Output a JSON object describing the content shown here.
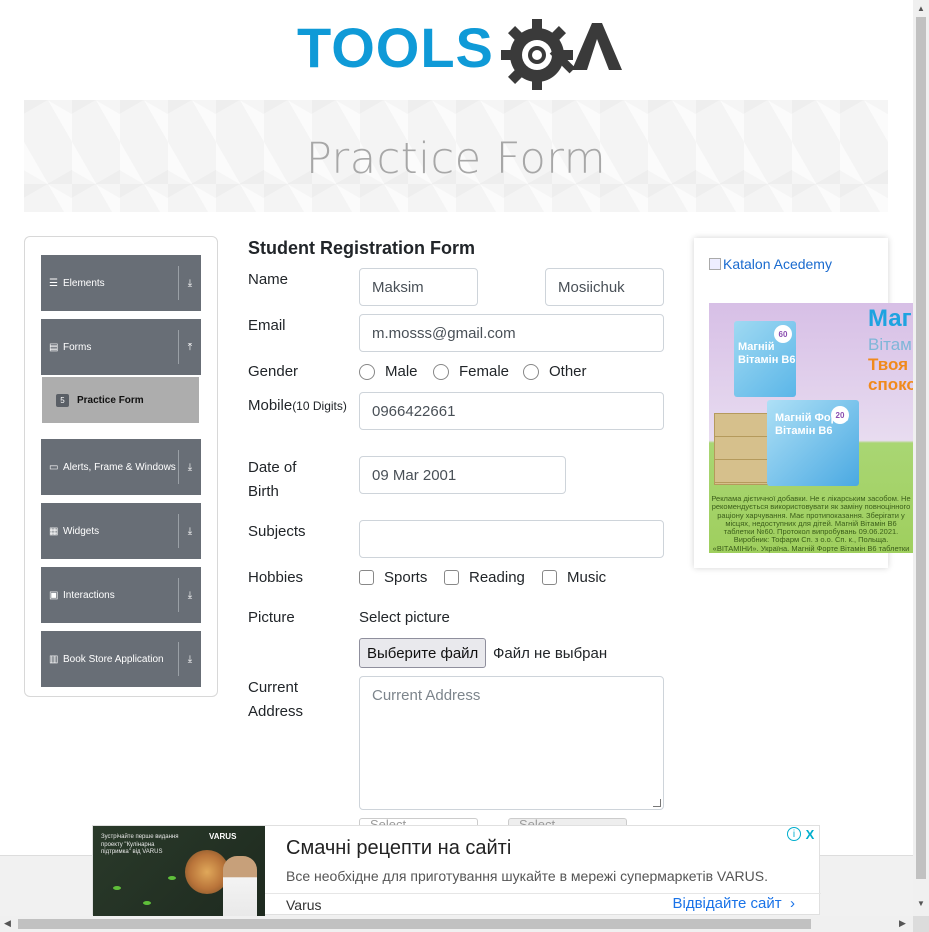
{
  "site": {
    "logo_text": "TOOLSQA"
  },
  "banner": {
    "title": "Practice Form"
  },
  "sidebar": {
    "groups": [
      {
        "label": "Elements",
        "icon": "menu-icon"
      },
      {
        "label": "Forms",
        "icon": "document-icon"
      },
      {
        "label": "Alerts, Frame & Windows",
        "icon": "window-icon"
      },
      {
        "label": "Widgets",
        "icon": "grid-icon"
      },
      {
        "label": "Interactions",
        "icon": "interaction-icon"
      },
      {
        "label": "Book Store Application",
        "icon": "bar-chart-icon"
      }
    ],
    "active_item": {
      "label": "Practice Form",
      "icon": "html5-icon"
    }
  },
  "form": {
    "title": "Student Registration Form",
    "name_label": "Name",
    "first_name": "Maksim",
    "last_name": "Mosiichuk",
    "email_label": "Email",
    "email": "m.mosss@gmail.com",
    "gender_label": "Gender",
    "gender_options": [
      "Male",
      "Female",
      "Other"
    ],
    "mobile_label": "Mobile",
    "mobile_hint": "(10 Digits)",
    "mobile": "0966422661",
    "dob_label": "Date of Birth",
    "dob": "09 Mar 2001",
    "subjects_label": "Subjects",
    "hobbies_label": "Hobbies",
    "hobbies": [
      "Sports",
      "Reading",
      "Music"
    ],
    "picture_label": "Picture",
    "picture_prompt": "Select picture",
    "file_button": "Выберите файл",
    "file_status": "Файл не выбран",
    "address_label": "Current Address",
    "address_placeholder": "Current Address",
    "state_placeholder": "Select...",
    "city_placeholder": "Select..."
  },
  "right_ad": {
    "alt_text": "Katalon Acedemy",
    "product_1": "Магній Вітамін B6",
    "product_2": "Магній Форте Вітамін B6",
    "badge_1": "60",
    "badge_2": "20",
    "headline_1": "Магн",
    "headline_2": "Вітам",
    "headline_3": "Твоя",
    "headline_4": "споко",
    "fine_print": "Реклама дієтичної добавки. Не є лікарським засобом. Не рекомендується використовувати як заміну повноцінного раціону харчування. Має протипоказання. Зберігати у місцях, недоступних для дітей. Магній Вітамін B6 таблетки №60. Протокол випробувань 09.06.2021. Виробник: Тофарм Сп. з о.о. Сп. к., Польща. «ВІТАМІНИ». Україна. Магній Форте Вітамін B6 таблетки №20, висновок від 30.11.2021 ДУ 'Інститут громадського здоров'я ім. О.М. Марзєєва'. Найменування та місце знаходження імпортера: АТ"
  },
  "bottom_ad": {
    "promo_text": "Зустрічайте перше видання проекту \"Кулінарна підтримка\" від VARUS",
    "brand_small": "VARUS",
    "title": "Смачні рецепти на сайті",
    "description": "Все необхідне для приготування шукайте в мережі супермаркетів VARUS.",
    "advertiser": "Varus",
    "cta": "Відвідайте сайт",
    "info_icon": "i",
    "close_icon": "X"
  },
  "colors": {
    "logo_blue": "#0f9ad7",
    "logo_dark": "#3a3a3a",
    "sidebar_group": "#686e76",
    "sidebar_active": "#adadad",
    "link_blue": "#1a73e8"
  }
}
